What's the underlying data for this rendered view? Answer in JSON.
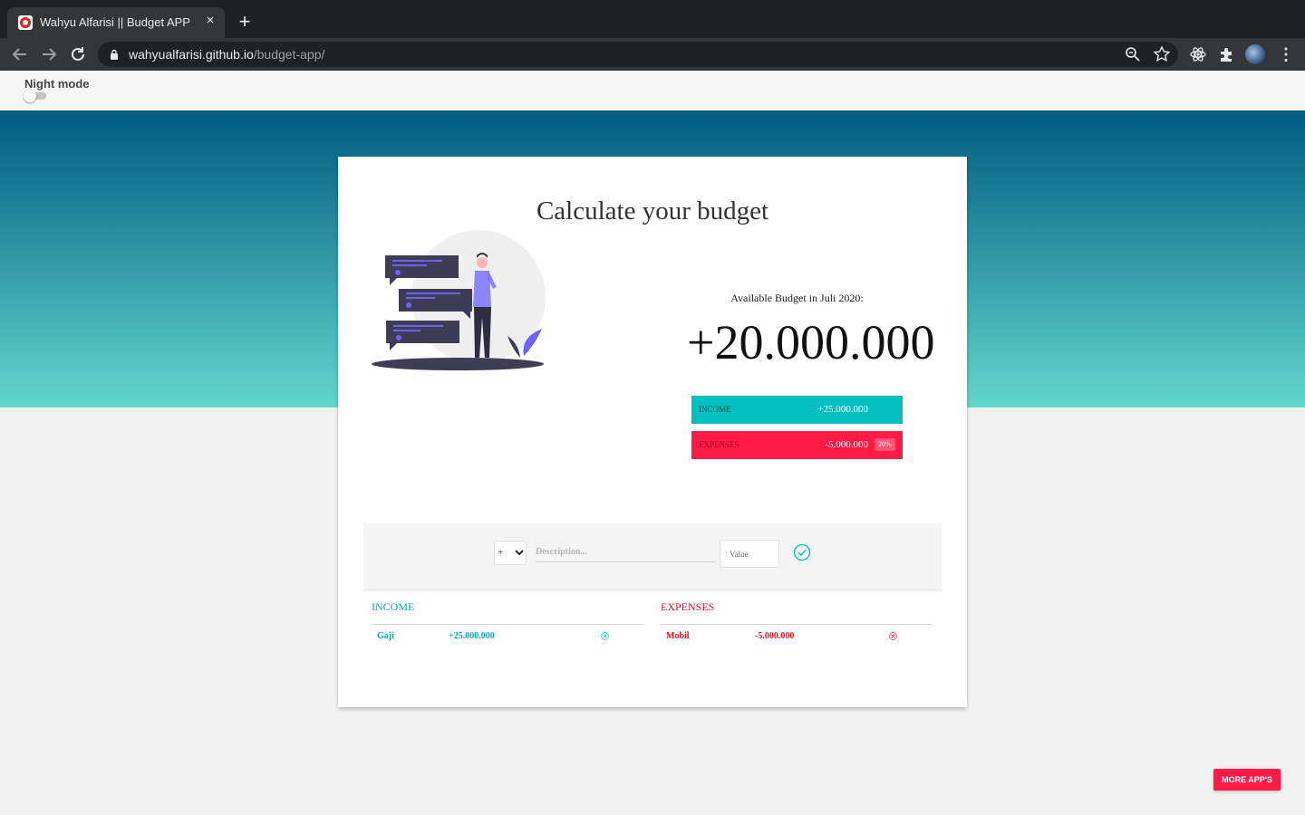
{
  "browser": {
    "tab_title": "Wahyu Alfarisi || Budget APP",
    "tab_close": "×",
    "new_tab": "+",
    "url_host": "wahyualfarisi.github.io",
    "url_path": "/budget-app/",
    "icons": [
      "back-arrow",
      "forward-arrow",
      "reload",
      "lock",
      "zoom",
      "star",
      "react-devtools",
      "extensions",
      "profile-avatar",
      "menu"
    ]
  },
  "night_mode": {
    "label": "Night mode",
    "enabled": false
  },
  "budget": {
    "title": "Calculate your budget",
    "available_label": "Available Budget in Juli 2020:",
    "available_value": "+20.000.000",
    "income_label": "INCOME",
    "income_value": "+25.000.000",
    "expenses_label": "EXPENSES",
    "expenses_value": "-5.000.000",
    "expenses_percent": "20%"
  },
  "add_form": {
    "type_value": "+",
    "description_placeholder": "Description...",
    "value_placeholder": "Value"
  },
  "lists": {
    "income_title": "INCOME",
    "expenses_title": "EXPENSES",
    "income_items": [
      {
        "description": "Gaji",
        "value": "+25.000.000"
      }
    ],
    "expenses_items": [
      {
        "description": "Mobil",
        "value": "-5.000.000"
      }
    ]
  },
  "more_apps_label": "MORE APP'S",
  "colors": {
    "income": "#04bfbf",
    "expenses": "#ff1b45",
    "hero_top": "#005b80",
    "hero_bottom": "#63d7cb"
  }
}
